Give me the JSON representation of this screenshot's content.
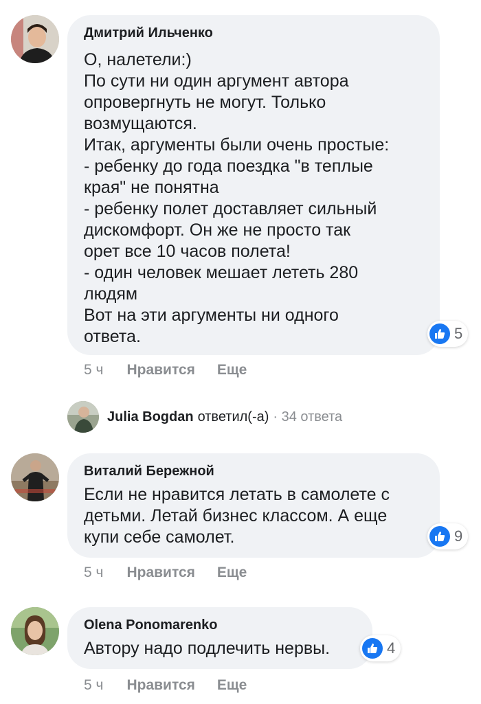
{
  "comments": [
    {
      "author": "Дмитрий Ильченко",
      "lines": [
        "О, налетели:)",
        "По сути ни один аргумент автора",
        "опровергнуть не могут. Только",
        "возмущаются.",
        "Итак, аргументы были очень простые:",
        "- ребенку до года поездка \"в теплые",
        "края\" не понятна",
        "- ребенку полет доставляет сильный",
        "дискомфорт. Он же не просто так",
        "орет все 10 часов полета!",
        "- один человек мешает лететь 280",
        "людям",
        "Вот на эти аргументы ни одного",
        "ответа."
      ],
      "likes": "5",
      "time": "5 ч",
      "like_label": "Нравится",
      "more_label": "Еще"
    },
    {
      "author": "Виталий Бережной",
      "lines": [
        "Если не нравится летать в самолете с",
        "детьми. Летай бизнес классом. А еще",
        "купи себе самолет."
      ],
      "likes": "9",
      "time": "5 ч",
      "like_label": "Нравится",
      "more_label": "Еще"
    },
    {
      "author": "Olena Ponomarenko",
      "lines": [
        "Автору надо подлечить нервы."
      ],
      "likes": "4",
      "time": "5 ч",
      "like_label": "Нравится",
      "more_label": "Еще"
    }
  ],
  "reply_summary": {
    "name": "Julia Bogdan",
    "verb": "ответил(-а)",
    "count": "· 34 ответа"
  },
  "colors": {
    "bubble": "#f0f2f5",
    "like_blue": "#1877f2",
    "muted": "#8a8d91"
  }
}
